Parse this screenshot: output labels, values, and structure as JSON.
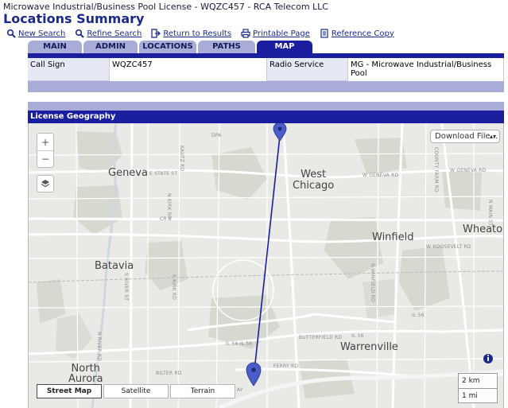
{
  "license_title": "Microwave Industrial/Business Pool License - WQZC457 - RCA Telecom LLC",
  "page_title": "Locations Summary",
  "links": [
    {
      "label": "New Search",
      "icon": "search-icon"
    },
    {
      "label": "Refine Search",
      "icon": "search-icon"
    },
    {
      "label": "Return to Results",
      "icon": "return-icon"
    },
    {
      "label": "Printable Page",
      "icon": "printer-icon"
    },
    {
      "label": "Reference Copy",
      "icon": "document-icon"
    }
  ],
  "tabs": [
    {
      "label": "MAIN",
      "active": false
    },
    {
      "label": "ADMIN",
      "active": false
    },
    {
      "label": "LOCATIONS",
      "active": false
    },
    {
      "label": "PATHS",
      "active": false
    },
    {
      "label": "MAP",
      "active": true
    }
  ],
  "summary": {
    "call_sign_label": "Call Sign",
    "call_sign_value": "WQZC457",
    "radio_service_label": "Radio Service",
    "radio_service_value": "MG - Microwave Industrial/Business Pool"
  },
  "section_header": "License Geography",
  "map": {
    "zoom_in": "+",
    "zoom_out": "−",
    "layers_icon": "layers-icon",
    "download_label": "Download File...",
    "map_types": [
      {
        "label": "Street Map",
        "active": true
      },
      {
        "label": "Satellite",
        "active": false
      },
      {
        "label": "Terrain",
        "active": false
      }
    ],
    "scale_km": "2 km",
    "scale_mi": "1 mi",
    "places": {
      "geneva": "Geneva",
      "west_chicago": "West\nChicago",
      "winfield": "Winfield",
      "wheaton": "Wheator",
      "batavia": "Batavia",
      "warrenville": "Warrenville",
      "north_aurora": "North\nAurora"
    },
    "roads": {
      "e_state_st": "E STATE ST",
      "w_geneva_rd_1": "W GENEVA RD",
      "w_geneva_rd_2": "W GENEVA RD",
      "cr8": "CR 8",
      "w_roosevelt_rd": "W ROOSEVELT RD",
      "il56_1": "IL 56",
      "il56_2": "IL 56",
      "il56_3": "IL 56 IL 56",
      "butterfield_rd": "BUTTERFIELD RD",
      "ferry_rd": "FERRY RD",
      "bilter_rd": "BILTER RD",
      "dpa": "DPA",
      "n_kirk_rd": "N KIRK RD",
      "s_kirk_rd": "S KIRK RD",
      "kautz_rd": "KAUTZ RD",
      "s_river_st": "S RIVER ST",
      "n_river_rd": "N RIVER RD",
      "winfield_rd": "N WINFIELD RD",
      "county_farm_rd": "COUNTY FARM RD",
      "n_main_st": "N MAIN ST",
      "w_geneva_rd_3": "W GENEVA RD",
      "ay": "AY"
    }
  }
}
